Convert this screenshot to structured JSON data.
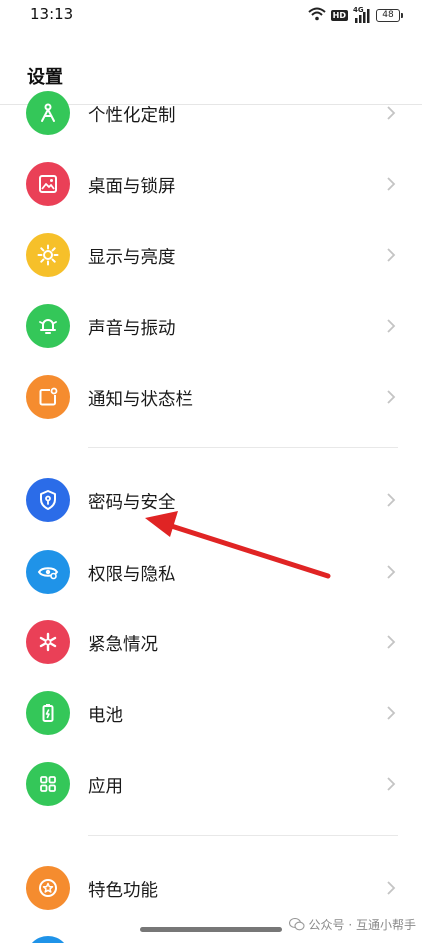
{
  "status_bar": {
    "time": "13:13",
    "hd": "HD",
    "network": "4G",
    "battery": "48"
  },
  "header": {
    "title": "设置"
  },
  "groups": [
    {
      "items": [
        {
          "label": "个性化定制",
          "icon": "personalization-icon",
          "color": "#34c759"
        },
        {
          "label": "桌面与锁屏",
          "icon": "wallpaper-icon",
          "color": "#ea4057"
        },
        {
          "label": "显示与亮度",
          "icon": "brightness-icon",
          "color": "#f6c02a"
        },
        {
          "label": "声音与振动",
          "icon": "bell-icon",
          "color": "#34c759"
        },
        {
          "label": "通知与状态栏",
          "icon": "notification-icon",
          "color": "#f58c2f"
        }
      ]
    },
    {
      "items": [
        {
          "label": "密码与安全",
          "icon": "shield-icon",
          "color": "#2b6ce8"
        },
        {
          "label": "权限与隐私",
          "icon": "eye-privacy-icon",
          "color": "#1f93e8"
        },
        {
          "label": "紧急情况",
          "icon": "emergency-icon",
          "color": "#ea4057"
        },
        {
          "label": "电池",
          "icon": "battery-icon",
          "color": "#34c759"
        },
        {
          "label": "应用",
          "icon": "apps-grid-icon",
          "color": "#34c759"
        }
      ]
    },
    {
      "items": [
        {
          "label": "特色功能",
          "icon": "star-icon",
          "color": "#f58c2f"
        }
      ]
    }
  ],
  "watermark": {
    "text": "公众号 · 互通小帮手",
    "icon": "wechat-icon"
  },
  "annotation": {
    "type": "red-arrow",
    "target": "密码与安全",
    "color": "#e02424"
  }
}
